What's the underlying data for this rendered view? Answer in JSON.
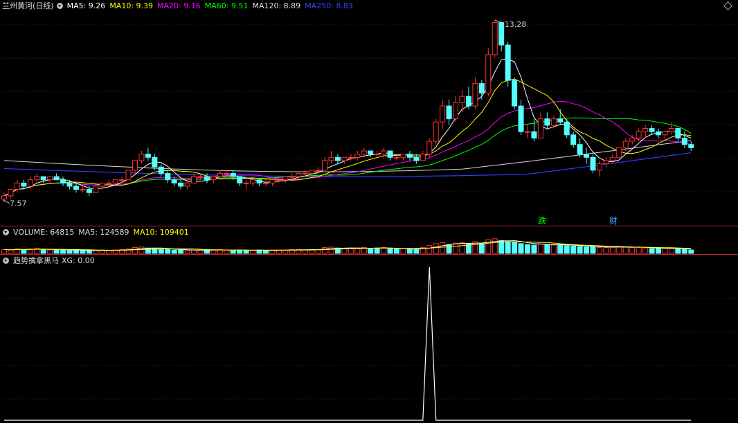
{
  "price_panel": {
    "title": "兰州黄河(日线)",
    "ma5": "MA5: 9.26",
    "ma10": "MA10: 9.39",
    "ma20": "MA20: 9.16",
    "ma60": "MA60: 9.51",
    "ma120": "MA120: 8.89",
    "ma250": "MA250: 8.83",
    "high_label": "13.28",
    "low_label": "7.57",
    "marker_die": "跌",
    "marker_cai": "财"
  },
  "volume_panel": {
    "vol": "VOLUME: 64815",
    "ma5": "MA5: 124589",
    "ma10": "MA10: 109401"
  },
  "indicator_panel": {
    "name": "趋势擒拿黑马",
    "xg": "XG: 0.00"
  },
  "colors": {
    "up": "#ff3232",
    "down": "#54ffff",
    "ma5": "#ffffff",
    "ma10": "#ffff00",
    "ma20": "#ff00ff",
    "ma60": "#00ff00",
    "ma120": "#d9d9d9",
    "ma250": "#2f3cff",
    "grid": "#7a1515"
  },
  "chart_data": {
    "type": "candlestick",
    "title": "兰州黄河(日线)",
    "price_range": [
      7.57,
      13.28
    ],
    "candles": [
      [
        7.7,
        7.9,
        7.6,
        7.8
      ],
      [
        7.8,
        8.0,
        7.7,
        8.0
      ],
      [
        8.0,
        8.3,
        7.9,
        8.2
      ],
      [
        8.2,
        8.3,
        8.0,
        8.1
      ],
      [
        8.1,
        8.4,
        8.0,
        8.3
      ],
      [
        8.3,
        8.5,
        8.2,
        8.4
      ],
      [
        8.4,
        8.4,
        8.2,
        8.3
      ],
      [
        8.3,
        8.4,
        8.2,
        8.4
      ],
      [
        8.4,
        8.5,
        8.3,
        8.3
      ],
      [
        8.3,
        8.4,
        8.1,
        8.2
      ],
      [
        8.2,
        8.3,
        8.0,
        8.1
      ],
      [
        8.1,
        8.2,
        7.9,
        8.0
      ],
      [
        8.0,
        8.1,
        7.9,
        8.0
      ],
      [
        8.0,
        8.1,
        7.8,
        7.9
      ],
      [
        7.9,
        8.1,
        7.9,
        8.1
      ],
      [
        8.1,
        8.2,
        8.0,
        8.2
      ],
      [
        8.2,
        8.3,
        8.1,
        8.2
      ],
      [
        8.2,
        8.3,
        8.1,
        8.3
      ],
      [
        8.3,
        8.4,
        8.2,
        8.3
      ],
      [
        8.3,
        8.6,
        8.3,
        8.6
      ],
      [
        8.6,
        8.9,
        8.5,
        8.9
      ],
      [
        8.9,
        9.2,
        8.8,
        9.1
      ],
      [
        9.1,
        9.3,
        8.9,
        9.0
      ],
      [
        9.0,
        9.1,
        8.6,
        8.7
      ],
      [
        8.7,
        8.8,
        8.4,
        8.5
      ],
      [
        8.5,
        8.6,
        8.2,
        8.3
      ],
      [
        8.3,
        8.4,
        8.1,
        8.2
      ],
      [
        8.2,
        8.3,
        8.0,
        8.1
      ],
      [
        8.1,
        8.3,
        8.0,
        8.2
      ],
      [
        8.2,
        8.5,
        8.2,
        8.4
      ],
      [
        8.4,
        8.5,
        8.3,
        8.4
      ],
      [
        8.4,
        8.5,
        8.2,
        8.3
      ],
      [
        8.3,
        8.4,
        8.2,
        8.4
      ],
      [
        8.4,
        8.6,
        8.3,
        8.5
      ],
      [
        8.5,
        8.6,
        8.4,
        8.5
      ],
      [
        8.5,
        8.6,
        8.3,
        8.4
      ],
      [
        8.4,
        8.4,
        8.1,
        8.2
      ],
      [
        8.2,
        8.3,
        8.0,
        8.2
      ],
      [
        8.2,
        8.3,
        8.1,
        8.3
      ],
      [
        8.3,
        8.3,
        8.1,
        8.2
      ],
      [
        8.2,
        8.3,
        8.1,
        8.2
      ],
      [
        8.2,
        8.3,
        8.1,
        8.3
      ],
      [
        8.3,
        8.4,
        8.2,
        8.3
      ],
      [
        8.3,
        8.4,
        8.2,
        8.4
      ],
      [
        8.4,
        8.5,
        8.3,
        8.4
      ],
      [
        8.4,
        8.5,
        8.3,
        8.5
      ],
      [
        8.5,
        8.6,
        8.4,
        8.5
      ],
      [
        8.5,
        8.6,
        8.4,
        8.6
      ],
      [
        8.6,
        8.7,
        8.5,
        8.6
      ],
      [
        8.6,
        9.0,
        8.6,
        8.9
      ],
      [
        8.9,
        9.2,
        8.8,
        9.0
      ],
      [
        9.0,
        9.1,
        8.8,
        8.9
      ],
      [
        8.9,
        9.0,
        8.8,
        9.0
      ],
      [
        9.0,
        9.1,
        8.9,
        9.0
      ],
      [
        9.0,
        9.2,
        8.9,
        9.1
      ],
      [
        9.1,
        9.3,
        9.0,
        9.2
      ],
      [
        9.2,
        9.2,
        9.0,
        9.1
      ],
      [
        9.1,
        9.2,
        9.0,
        9.1
      ],
      [
        9.1,
        9.3,
        9.0,
        9.2
      ],
      [
        9.2,
        9.2,
        8.9,
        9.0
      ],
      [
        9.0,
        9.1,
        8.9,
        9.0
      ],
      [
        9.0,
        9.1,
        8.9,
        9.1
      ],
      [
        9.1,
        9.2,
        8.9,
        9.0
      ],
      [
        9.0,
        9.1,
        8.8,
        8.9
      ],
      [
        8.9,
        9.2,
        8.9,
        9.1
      ],
      [
        9.1,
        9.6,
        9.0,
        9.5
      ],
      [
        9.5,
        10.2,
        9.4,
        10.1
      ],
      [
        10.1,
        10.8,
        9.9,
        10.6
      ],
      [
        10.6,
        10.8,
        10.0,
        10.2
      ],
      [
        10.2,
        10.9,
        10.1,
        10.7
      ],
      [
        10.7,
        11.1,
        10.4,
        10.9
      ],
      [
        10.9,
        11.2,
        10.5,
        10.6
      ],
      [
        10.6,
        11.5,
        10.5,
        11.3
      ],
      [
        11.3,
        11.4,
        10.8,
        11.0
      ],
      [
        11.0,
        12.4,
        10.9,
        12.2
      ],
      [
        12.2,
        13.28,
        12.1,
        13.2
      ],
      [
        13.2,
        13.2,
        12.3,
        12.5
      ],
      [
        12.5,
        12.6,
        11.2,
        11.4
      ],
      [
        11.4,
        11.5,
        10.5,
        10.6
      ],
      [
        10.6,
        10.8,
        9.7,
        9.8
      ],
      [
        9.8,
        10.0,
        9.6,
        9.8
      ],
      [
        9.8,
        10.2,
        9.5,
        9.6
      ],
      [
        9.6,
        10.4,
        9.6,
        10.2
      ],
      [
        10.2,
        10.4,
        9.9,
        10.0
      ],
      [
        10.0,
        10.3,
        9.9,
        10.2
      ],
      [
        10.2,
        10.5,
        10.0,
        10.1
      ],
      [
        10.1,
        10.2,
        9.6,
        9.7
      ],
      [
        9.7,
        9.8,
        9.3,
        9.4
      ],
      [
        9.4,
        9.6,
        9.0,
        9.1
      ],
      [
        9.1,
        9.3,
        8.8,
        9.0
      ],
      [
        9.0,
        9.1,
        8.5,
        8.6
      ],
      [
        8.6,
        8.9,
        8.4,
        8.8
      ],
      [
        8.8,
        9.0,
        8.7,
        8.9
      ],
      [
        8.9,
        9.1,
        8.8,
        9.0
      ],
      [
        9.0,
        9.3,
        9.0,
        9.3
      ],
      [
        9.3,
        9.6,
        9.2,
        9.5
      ],
      [
        9.5,
        9.7,
        9.4,
        9.6
      ],
      [
        9.6,
        9.9,
        9.5,
        9.8
      ],
      [
        9.8,
        10.0,
        9.6,
        9.9
      ],
      [
        9.9,
        10.0,
        9.7,
        9.8
      ],
      [
        9.8,
        9.9,
        9.6,
        9.7
      ],
      [
        9.7,
        9.8,
        9.5,
        9.8
      ],
      [
        9.8,
        10.1,
        9.7,
        9.9
      ],
      [
        9.9,
        9.9,
        9.5,
        9.6
      ],
      [
        9.6,
        9.8,
        9.3,
        9.4
      ],
      [
        9.4,
        9.5,
        9.2,
        9.3
      ]
    ],
    "volume": {
      "bars": [
        8,
        7,
        9,
        8,
        9,
        10,
        8,
        7,
        8,
        7,
        6,
        7,
        6,
        5,
        6,
        7,
        6,
        7,
        8,
        9,
        12,
        13,
        11,
        10,
        9,
        8,
        7,
        7,
        6,
        7,
        7,
        6,
        7,
        8,
        7,
        6,
        7,
        6,
        6,
        7,
        6,
        6,
        7,
        7,
        8,
        8,
        7,
        8,
        8,
        12,
        13,
        11,
        10,
        10,
        11,
        12,
        10,
        11,
        12,
        10,
        9,
        10,
        9,
        8,
        12,
        16,
        20,
        22,
        18,
        21,
        22,
        19,
        24,
        20,
        28,
        30,
        26,
        24,
        22,
        20,
        18,
        17,
        19,
        18,
        17,
        18,
        16,
        15,
        14,
        13,
        14,
        12,
        12,
        13,
        14,
        13,
        12,
        12,
        11,
        10,
        11,
        10,
        10,
        9,
        8,
        7
      ],
      "up_flags": [
        1,
        1,
        1,
        0,
        1,
        1,
        0,
        1,
        0,
        0,
        0,
        0,
        0,
        0,
        1,
        1,
        1,
        1,
        1,
        1,
        1,
        1,
        0,
        0,
        0,
        0,
        0,
        0,
        1,
        1,
        1,
        0,
        1,
        1,
        1,
        0,
        0,
        0,
        1,
        0,
        0,
        1,
        1,
        1,
        1,
        1,
        1,
        1,
        1,
        1,
        1,
        0,
        1,
        1,
        1,
        1,
        0,
        0,
        1,
        0,
        0,
        1,
        0,
        0,
        1,
        1,
        1,
        1,
        0,
        1,
        1,
        0,
        1,
        0,
        1,
        1,
        0,
        0,
        0,
        0,
        0,
        0,
        1,
        0,
        1,
        0,
        0,
        0,
        0,
        0,
        0,
        1,
        1,
        1,
        1,
        1,
        1,
        1,
        1,
        0,
        0,
        1,
        1,
        0,
        0,
        0
      ]
    },
    "xg_signal_index": 65
  }
}
